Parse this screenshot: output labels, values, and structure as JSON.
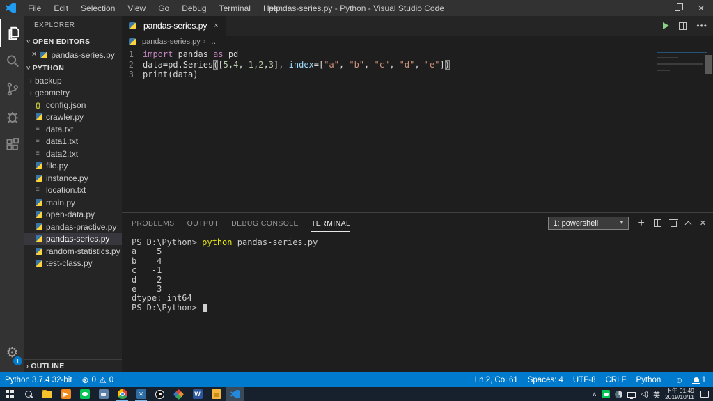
{
  "title_bar": {
    "menus": [
      "File",
      "Edit",
      "Selection",
      "View",
      "Go",
      "Debug",
      "Terminal",
      "Help"
    ],
    "title": "pandas-series.py - Python - Visual Studio Code"
  },
  "activity_bar": {
    "items": [
      "explorer",
      "search",
      "source-control",
      "debug",
      "extensions"
    ],
    "manage_badge": "1"
  },
  "sidebar": {
    "title": "EXPLORER",
    "open_editors": {
      "header": "OPEN EDITORS",
      "items": [
        {
          "label": "pandas-series.py",
          "icon": "py"
        }
      ]
    },
    "explorer_section": {
      "header": "PYTHON",
      "items": [
        {
          "label": "backup",
          "type": "folder"
        },
        {
          "label": "geometry",
          "type": "folder"
        },
        {
          "label": "config.json",
          "type": "json"
        },
        {
          "label": "crawler.py",
          "type": "py"
        },
        {
          "label": "data.txt",
          "type": "txt"
        },
        {
          "label": "data1.txt",
          "type": "txt"
        },
        {
          "label": "data2.txt",
          "type": "txt"
        },
        {
          "label": "file.py",
          "type": "py"
        },
        {
          "label": "instance.py",
          "type": "py"
        },
        {
          "label": "location.txt",
          "type": "txt"
        },
        {
          "label": "main.py",
          "type": "py"
        },
        {
          "label": "open-data.py",
          "type": "py"
        },
        {
          "label": "pandas-practive.py",
          "type": "py"
        },
        {
          "label": "pandas-series.py",
          "type": "py",
          "selected": true
        },
        {
          "label": "random-statistics.py",
          "type": "py"
        },
        {
          "label": "test-class.py",
          "type": "py"
        }
      ]
    },
    "outline_header": "OUTLINE"
  },
  "editor": {
    "tab": {
      "label": "pandas-series.py",
      "close": "×"
    },
    "breadcrumb": {
      "file": "pandas-series.py",
      "more": "…"
    },
    "code_lines": [
      {
        "num": "1",
        "tokens": [
          [
            "import",
            "kw"
          ],
          [
            " pandas ",
            "pl"
          ],
          [
            "as",
            "kw"
          ],
          [
            " pd",
            "pl"
          ]
        ]
      },
      {
        "num": "2",
        "tokens": [
          [
            "data=pd.Series",
            "pl"
          ],
          [
            "(",
            "match"
          ],
          [
            "[",
            "pl"
          ],
          [
            "5",
            "num"
          ],
          [
            ",",
            "pl"
          ],
          [
            "4",
            "num"
          ],
          [
            ",",
            "pl"
          ],
          [
            "-1",
            "num"
          ],
          [
            ",",
            "pl"
          ],
          [
            "2",
            "num"
          ],
          [
            ",",
            "pl"
          ],
          [
            "3",
            "num"
          ],
          [
            "], ",
            "pl"
          ],
          [
            "index",
            "param"
          ],
          [
            "=[",
            "pl"
          ],
          [
            "\"a\"",
            "str"
          ],
          [
            ", ",
            "pl"
          ],
          [
            "\"b\"",
            "str"
          ],
          [
            ", ",
            "pl"
          ],
          [
            "\"c\"",
            "str"
          ],
          [
            ", ",
            "pl"
          ],
          [
            "\"d\"",
            "str"
          ],
          [
            ", ",
            "pl"
          ],
          [
            "\"e\"",
            "str"
          ],
          [
            "]",
            "pl"
          ],
          [
            ")",
            "match"
          ]
        ]
      },
      {
        "num": "3",
        "tokens": [
          [
            "print(data)",
            "pl"
          ]
        ]
      }
    ]
  },
  "panel": {
    "tabs": [
      "PROBLEMS",
      "OUTPUT",
      "DEBUG CONSOLE",
      "TERMINAL"
    ],
    "active_tab": "TERMINAL",
    "shell_selector": "1: powershell",
    "terminal_lines": [
      [
        [
          "PS D:\\Python> ",
          "pl"
        ],
        [
          "python",
          "cmd"
        ],
        [
          " pandas-series.py",
          "pl"
        ]
      ],
      [
        [
          "a    5",
          "pl"
        ]
      ],
      [
        [
          "b    4",
          "pl"
        ]
      ],
      [
        [
          "c   -1",
          "pl"
        ]
      ],
      [
        [
          "d    2",
          "pl"
        ]
      ],
      [
        [
          "e    3",
          "pl"
        ]
      ],
      [
        [
          "dtype: int64",
          "pl"
        ]
      ],
      [
        [
          "PS D:\\Python> ",
          "pl"
        ],
        [
          "",
          "cursor"
        ]
      ]
    ]
  },
  "status_bar": {
    "python_version": "Python 3.7.4 32-bit",
    "errors": "0",
    "warnings": "0",
    "right_items": [
      "Ln 2, Col 61",
      "Spaces: 4",
      "UTF-8",
      "CRLF",
      "Python"
    ],
    "smiley": "☺",
    "bell_count": "1"
  },
  "taskbar": {
    "items": [
      {
        "name": "start-button"
      },
      {
        "name": "taskbar-search"
      },
      {
        "name": "file-explorer"
      },
      {
        "name": "media-player"
      },
      {
        "name": "line-messenger"
      },
      {
        "name": "chat-app"
      },
      {
        "name": "chrome",
        "running": true
      },
      {
        "name": "x-app",
        "running": true
      },
      {
        "name": "target-app"
      },
      {
        "name": "drawio"
      },
      {
        "name": "word"
      },
      {
        "name": "sticky-notes"
      },
      {
        "name": "vscode",
        "active": true
      }
    ],
    "tray": {
      "language": "英",
      "time": "下午 01:49",
      "date": "2019/10/11"
    }
  }
}
